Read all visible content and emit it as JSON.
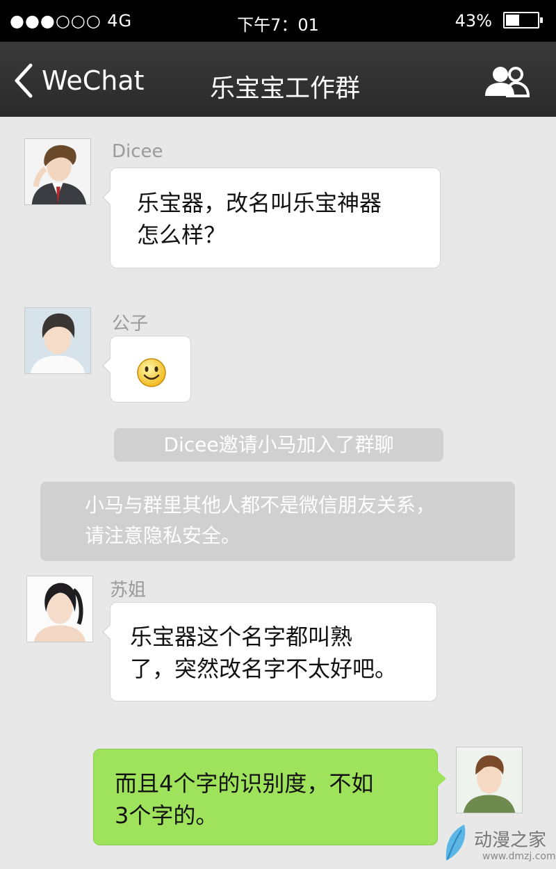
{
  "status_bar": {
    "signal": "●●●○○○ 4G",
    "time": "下午7：01",
    "battery_pct": "43%",
    "battery_level": 0.43
  },
  "nav": {
    "back_label": "WeChat",
    "title": "乐宝宝工作群"
  },
  "messages": [
    {
      "sender": "Dicee",
      "text": "乐宝器，改名叫乐宝神器\n怎么样？"
    },
    {
      "sender": "公子",
      "text": "🙂"
    },
    {
      "system": "Dicee邀请小马加入了群聊"
    },
    {
      "system": "小马与群里其他人都不是微信朋友关系，\n请注意隐私安全。"
    },
    {
      "sender": "苏姐",
      "text": "乐宝器这个名字都叫熟\n了，突然改名字不太好吧。"
    },
    {
      "text": "而且4个字的识别度，不如\n3个字的。"
    }
  ],
  "watermark": {
    "brand": "动漫之家",
    "url": "www.dmzj.com"
  }
}
